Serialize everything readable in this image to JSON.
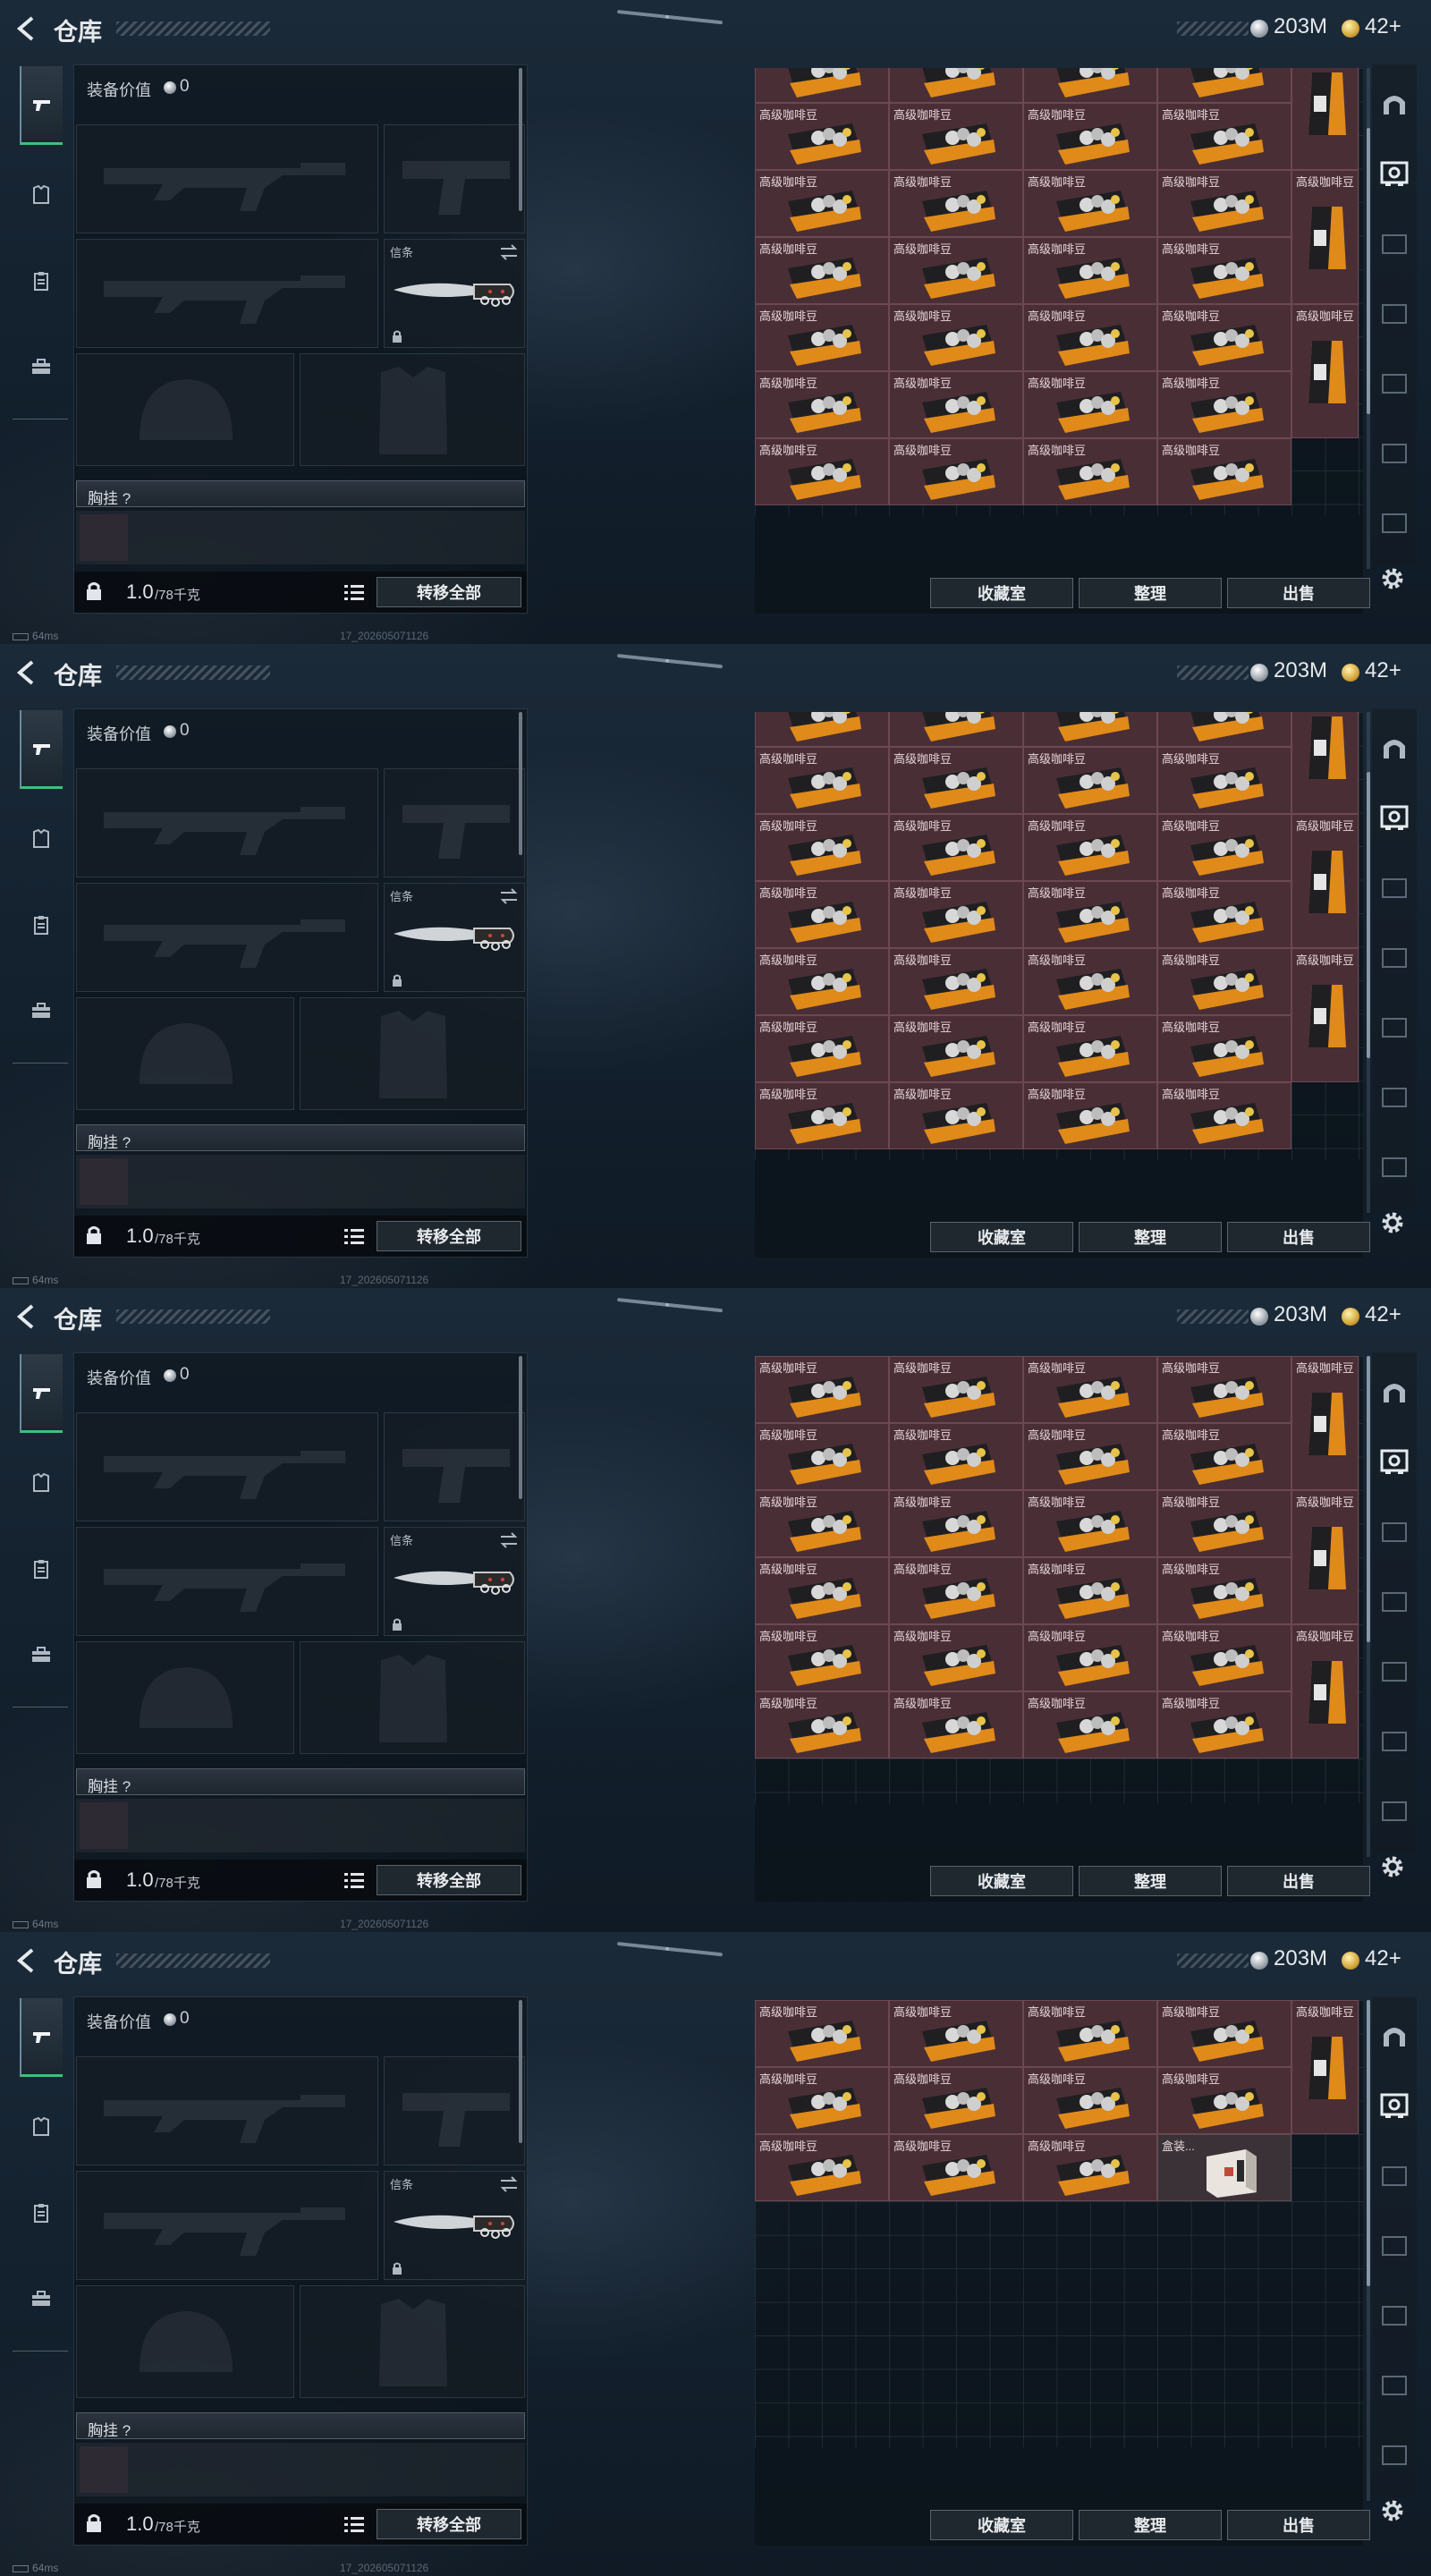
{
  "header": {
    "title": "仓库",
    "silver_amount": "203M",
    "gold_amount": "42+"
  },
  "sidebar": {
    "tabs": [
      {
        "name": "weapons",
        "icon": "pistol-icon",
        "active": true
      },
      {
        "name": "armor",
        "icon": "armor-icon",
        "active": false
      },
      {
        "name": "supplies",
        "icon": "clipboard-icon",
        "active": false
      },
      {
        "name": "backpack",
        "icon": "briefcase-icon",
        "active": false
      }
    ]
  },
  "equipment": {
    "value_label": "装备价值",
    "value_amount": "0",
    "melee_label": "信条",
    "vest_label": "胸挂 ?",
    "weight_main": "1.0",
    "weight_sub": "/78千克",
    "transfer_all": "转移全部"
  },
  "stash": {
    "buttons": [
      "收藏室",
      "整理",
      "出售"
    ],
    "item_coffee": "高级咖啡豆",
    "item_box": "盒装...",
    "colors": {
      "cell_bg": "#4a2e36",
      "cell_border": "#6c4853",
      "accent_orange": "#e08a1a"
    },
    "frames": [
      {
        "scroll_fraction": 0.28
      },
      {
        "scroll_fraction": 0.28
      },
      {
        "scroll_fraction": 0.0
      },
      {
        "scroll_fraction": 0.0
      }
    ]
  },
  "status": {
    "ping": "64ms",
    "build": "17_202605071126"
  }
}
